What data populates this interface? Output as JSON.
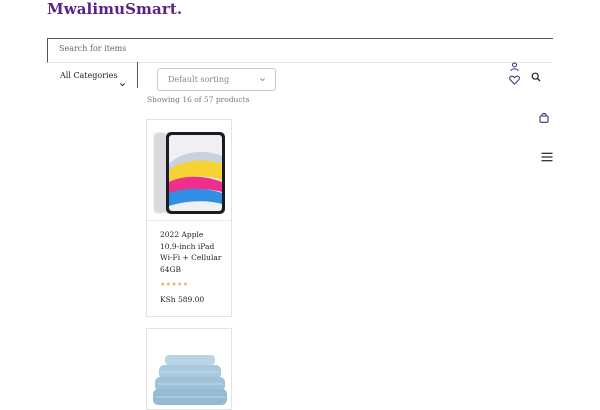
{
  "header": {
    "logo": "MwalimuSmart."
  },
  "search": {
    "placeholder": "Search for items"
  },
  "categories": {
    "label": "All Categories"
  },
  "sorting": {
    "selected": "Default sorting"
  },
  "results": {
    "showing": "Showing 16 of 57 products"
  },
  "icons": {
    "account": "user-icon",
    "wishlist": "heart-icon",
    "search": "search-icon",
    "cart": "shopping-bag-icon",
    "menu": "hamburger-menu-icon"
  },
  "colors": {
    "brand": "#5b1f86",
    "accent": "#3a2d7c",
    "stars": "#e0b06b"
  },
  "products": [
    {
      "title": "2022 Apple 10.9-inch iPad Wi-Fi + Cellular 64GB",
      "rating": 0,
      "stars": "★★★★★",
      "price": "KSh 589.00"
    },
    {
      "image": "folded-bedsheets"
    }
  ]
}
